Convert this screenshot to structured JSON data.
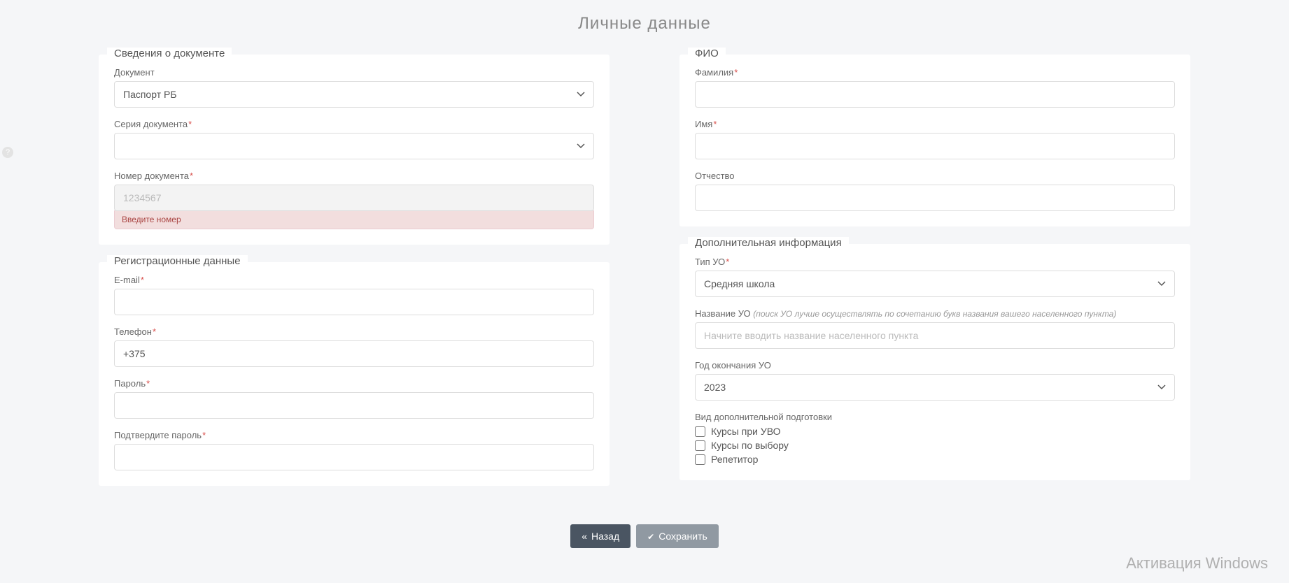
{
  "page": {
    "title": "Личные данные"
  },
  "doc": {
    "legend": "Сведения о документе",
    "type_label": "Документ",
    "type_value": "Паспорт РБ",
    "series_label": "Серия документа",
    "series_value": "",
    "number_label": "Номер документа",
    "number_placeholder": "1234567",
    "number_error": "Введите номер"
  },
  "reg": {
    "legend": "Регистрационные данные",
    "email_label": "E-mail",
    "phone_label": "Телефон",
    "phone_value": "+375",
    "password_label": "Пароль",
    "confirm_label": "Подтвердите пароль"
  },
  "fio": {
    "legend": "ФИО",
    "surname_label": "Фамилия",
    "name_label": "Имя",
    "patronymic_label": "Отчество"
  },
  "extra": {
    "legend": "Дополнительная информация",
    "type_uo_label": "Тип УО",
    "type_uo_value": "Средняя школа",
    "name_uo_label": "Название УО",
    "name_uo_hint": "(поиск УО лучше осуществлять по сочетанию букв названия вашего населенного пункта)",
    "name_uo_placeholder": "Начните вводить название населенного пункта",
    "year_label": "Год окончания УО",
    "year_value": "2023",
    "prep_label": "Вид дополнительной подготовки",
    "prep_opts": {
      "0": "Курсы при УВО",
      "1": "Курсы по выбору",
      "2": "Репетитор"
    }
  },
  "buttons": {
    "back": "Назад",
    "save": "Сохранить"
  },
  "activation": "Активация Windows",
  "required_mark": "*",
  "help_badge": "?"
}
